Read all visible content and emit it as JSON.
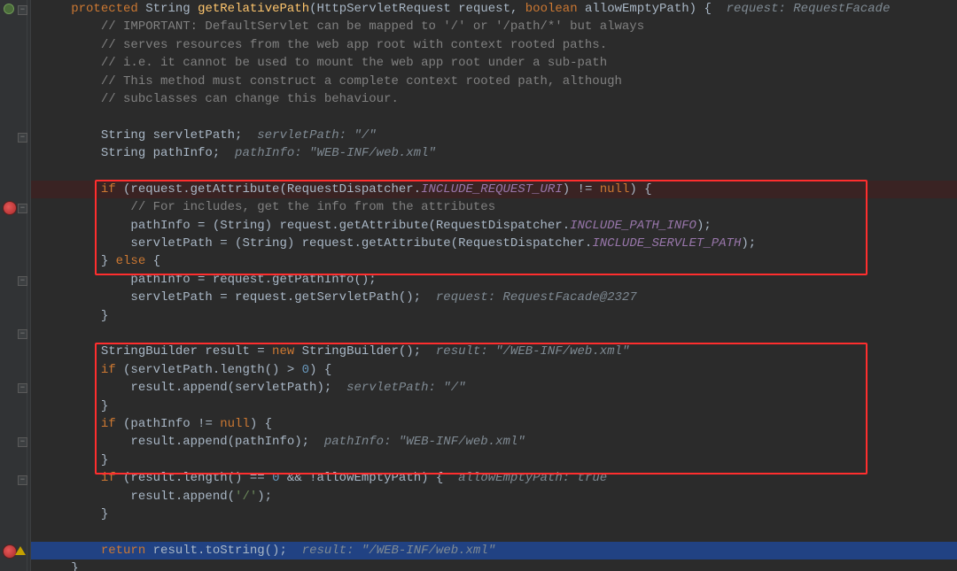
{
  "signature": {
    "modifier": "protected",
    "returnType": "String",
    "methodName": "getRelativePath",
    "param1Type": "HttpServletRequest",
    "param1Name": "request",
    "param2Type": "boolean",
    "param2Name": "allowEmptyPath",
    "brace": "{",
    "hint": "request: RequestFacade"
  },
  "comments": {
    "c1": "// IMPORTANT: DefaultServlet can be mapped to '/' or '/path/*' but always",
    "c2": "// serves resources from the web app root with context rooted paths.",
    "c3": "// i.e. it cannot be used to mount the web app root under a sub-path",
    "c4": "// This method must construct a complete context rooted path, although",
    "c5": "// subclasses can change this behaviour.",
    "c6": "// For includes, get the info from the attributes"
  },
  "decl": {
    "l1_a": "String servletPath;",
    "l1_hint": "servletPath: \"/\"",
    "l2_a": "String pathInfo;",
    "l2_hint": "pathInfo: \"WEB-INF/web.xml\""
  },
  "block1": {
    "ifKw": "if",
    "ifCond_a": " (request.getAttribute(RequestDispatcher.",
    "ifCond_const": "INCLUDE_REQUEST_URI",
    "ifCond_b": ") != ",
    "nullKw": "null",
    "ifCond_c": ") {",
    "p1_a": "pathInfo = (String) request.getAttribute(RequestDispatcher.",
    "p1_const": "INCLUDE_PATH_INFO",
    "p1_b": ");",
    "p2_a": "servletPath = (String) request.getAttribute(RequestDispatcher.",
    "p2_const": "INCLUDE_SERVLET_PATH",
    "p2_b": ");",
    "else_a": "} ",
    "elseKw": "else",
    "else_b": " {",
    "p3": "pathInfo = request.getPathInfo();",
    "p4": "servletPath = request.getServletPath();",
    "p4_hint": "request: RequestFacade@2327",
    "close": "}"
  },
  "block2": {
    "sb_a": "StringBuilder result = ",
    "sb_new": "new",
    "sb_b": " StringBuilder();",
    "sb_hint": "result: \"/WEB-INF/web.xml\"",
    "if1_kw": "if",
    "if1_cond": " (servletPath.length() > ",
    "if1_zero": "0",
    "if1_b": ") {",
    "ap1": "result.append(servletPath);",
    "ap1_hint": "servletPath: \"/\"",
    "close1": "}",
    "if2_kw": "if",
    "if2_cond": " (pathInfo != ",
    "if2_null": "null",
    "if2_b": ") {",
    "ap2": "result.append(pathInfo);",
    "ap2_hint": "pathInfo: \"WEB-INF/web.xml\"",
    "close2": "}"
  },
  "tail": {
    "if3_kw": "if",
    "if3_a": " (result.length() == ",
    "if3_zero": "0",
    "if3_b": " && !allowEmptyPath) {",
    "if3_hint": "allowEmptyPath: true",
    "ap3_a": "result.append(",
    "ap3_str": "'/'",
    "ap3_b": ");",
    "close3": "}",
    "ret_kw": "return",
    "ret_a": " result.toString();",
    "ret_hint": "result: \"/WEB-INF/web.xml\"",
    "finalClose": "}"
  }
}
